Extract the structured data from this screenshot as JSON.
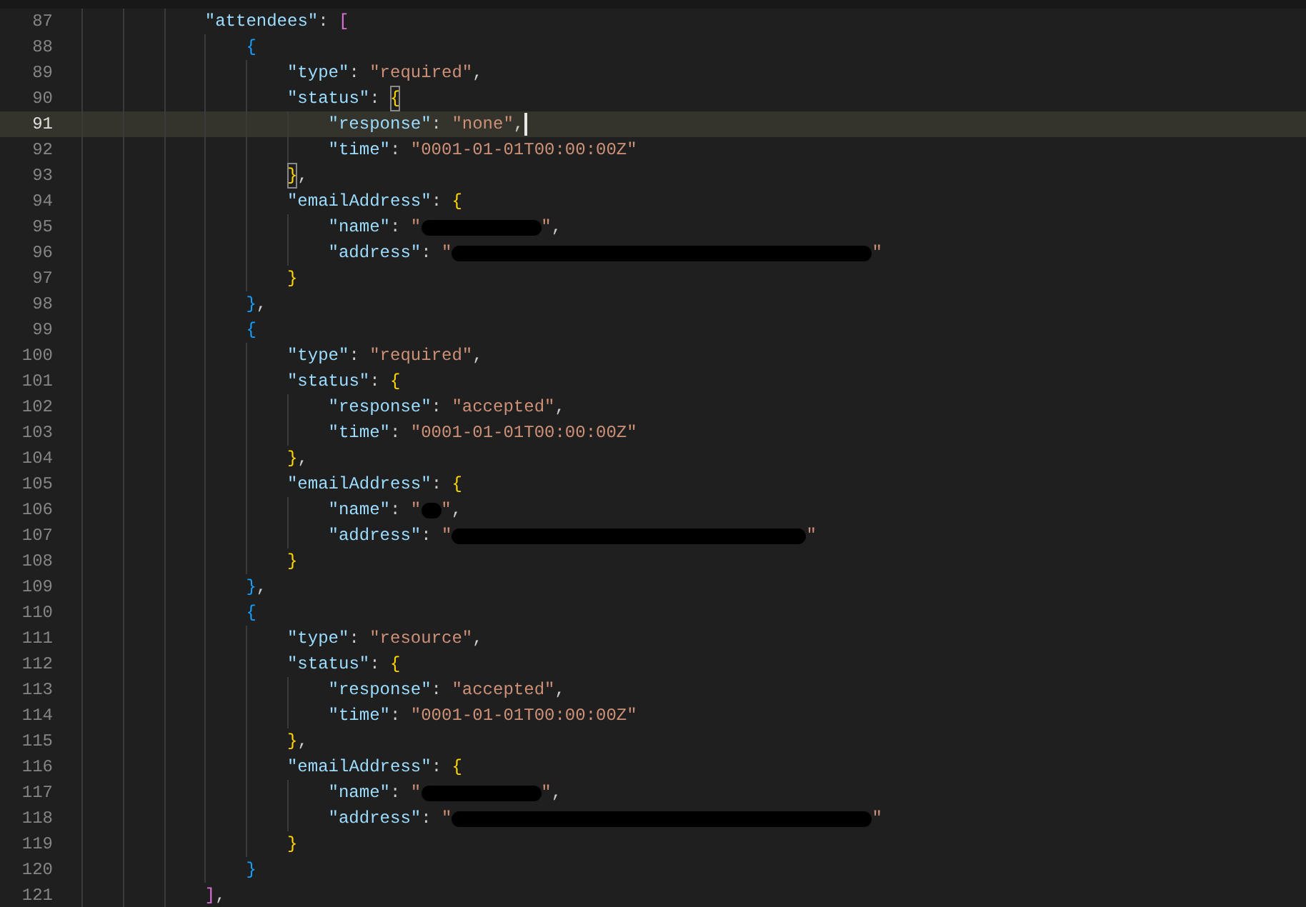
{
  "editor": {
    "lines": [
      {
        "number": "87",
        "current": false,
        "tokens": [
          {
            "kind": "key",
            "text": "\"attendees\""
          },
          {
            "kind": "punct",
            "text": ": "
          },
          {
            "kind": "bracket",
            "text": "[",
            "color": "#da70d6",
            "matched": false
          }
        ],
        "children": [
          {
            "number": "88",
            "current": false,
            "tokens": [
              {
                "kind": "bracket",
                "text": "{",
                "color": "#179fff",
                "matched": false
              }
            ],
            "children": [
              {
                "number": "89",
                "current": false,
                "tokens": [
                  {
                    "kind": "key",
                    "text": "\"type\""
                  },
                  {
                    "kind": "punct",
                    "text": ": "
                  },
                  {
                    "kind": "string",
                    "text": "\"required\""
                  },
                  {
                    "kind": "punct",
                    "text": ","
                  }
                ]
              },
              {
                "number": "90",
                "current": false,
                "tokens": [
                  {
                    "kind": "key",
                    "text": "\"status\""
                  },
                  {
                    "kind": "punct",
                    "text": ": "
                  },
                  {
                    "kind": "bracket",
                    "text": "{",
                    "color": "#ffd700",
                    "matched": true
                  }
                ],
                "children": [
                  {
                    "number": "91",
                    "current": true,
                    "tokens": [
                      {
                        "kind": "key",
                        "text": "\"response\""
                      },
                      {
                        "kind": "punct",
                        "text": ": "
                      },
                      {
                        "kind": "string",
                        "text": "\"none\""
                      },
                      {
                        "kind": "punct",
                        "text": ","
                      }
                    ]
                  },
                  {
                    "number": "92",
                    "current": false,
                    "tokens": [
                      {
                        "kind": "key",
                        "text": "\"time\""
                      },
                      {
                        "kind": "punct",
                        "text": ": "
                      },
                      {
                        "kind": "string",
                        "text": "\"0001-01-01T00:00:00Z\""
                      }
                    ]
                  }
                ]
              },
              {
                "number": "93",
                "current": false,
                "tokens": [
                  {
                    "kind": "bracket",
                    "text": "}",
                    "color": "#ffd700",
                    "matched": true
                  },
                  {
                    "kind": "punct",
                    "text": ","
                  }
                ]
              },
              {
                "number": "94",
                "current": false,
                "tokens": [
                  {
                    "kind": "key",
                    "text": "\"emailAddress\""
                  },
                  {
                    "kind": "punct",
                    "text": ": "
                  },
                  {
                    "kind": "bracket",
                    "text": "{",
                    "color": "#ffd700",
                    "matched": false
                  }
                ],
                "children": [
                  {
                    "number": "95",
                    "current": false,
                    "tokens": [
                      {
                        "kind": "key",
                        "text": "\"name\""
                      },
                      {
                        "kind": "punct",
                        "text": ": "
                      },
                      {
                        "kind": "string",
                        "text": "\""
                      },
                      {
                        "kind": "redaction-short"
                      },
                      {
                        "kind": "string",
                        "text": "\""
                      },
                      {
                        "kind": "punct",
                        "text": ","
                      }
                    ]
                  },
                  {
                    "number": "96",
                    "current": false,
                    "tokens": [
                      {
                        "kind": "key",
                        "text": "\"address\""
                      },
                      {
                        "kind": "punct",
                        "text": ": "
                      },
                      {
                        "kind": "string",
                        "text": "\""
                      },
                      {
                        "kind": "redaction-long"
                      },
                      {
                        "kind": "string",
                        "text": "\""
                      }
                    ]
                  }
                ]
              },
              {
                "number": "97",
                "current": false,
                "tokens": [
                  {
                    "kind": "bracket",
                    "text": "}",
                    "color": "#ffd700",
                    "matched": false
                  }
                ]
              }
            ]
          },
          {
            "number": "98",
            "current": false,
            "tokens": [
              {
                "kind": "bracket",
                "text": "}",
                "color": "#179fff",
                "matched": false
              },
              {
                "kind": "punct",
                "text": ","
              }
            ]
          },
          {
            "number": "99",
            "current": false,
            "tokens": [
              {
                "kind": "bracket",
                "text": "{",
                "color": "#179fff",
                "matched": false
              }
            ],
            "children": [
              {
                "number": "100",
                "current": false,
                "tokens": [
                  {
                    "kind": "key",
                    "text": "\"type\""
                  },
                  {
                    "kind": "punct",
                    "text": ": "
                  },
                  {
                    "kind": "string",
                    "text": "\"required\""
                  },
                  {
                    "kind": "punct",
                    "text": ","
                  }
                ]
              },
              {
                "number": "101",
                "current": false,
                "tokens": [
                  {
                    "kind": "key",
                    "text": "\"status\""
                  },
                  {
                    "kind": "punct",
                    "text": ": "
                  },
                  {
                    "kind": "bracket",
                    "text": "{",
                    "color": "#ffd700",
                    "matched": false
                  }
                ],
                "children": [
                  {
                    "number": "102",
                    "current": false,
                    "tokens": [
                      {
                        "kind": "key",
                        "text": "\"response\""
                      },
                      {
                        "kind": "punct",
                        "text": ": "
                      },
                      {
                        "kind": "string",
                        "text": "\"accepted\""
                      },
                      {
                        "kind": "punct",
                        "text": ","
                      }
                    ]
                  },
                  {
                    "number": "103",
                    "current": false,
                    "tokens": [
                      {
                        "kind": "key",
                        "text": "\"time\""
                      },
                      {
                        "kind": "punct",
                        "text": ": "
                      },
                      {
                        "kind": "string",
                        "text": "\"0001-01-01T00:00:00Z\""
                      }
                    ]
                  }
                ]
              },
              {
                "number": "104",
                "current": false,
                "tokens": [
                  {
                    "kind": "bracket",
                    "text": "}",
                    "color": "#ffd700",
                    "matched": false
                  },
                  {
                    "kind": "punct",
                    "text": ","
                  }
                ]
              },
              {
                "number": "105",
                "current": false,
                "tokens": [
                  {
                    "kind": "key",
                    "text": "\"emailAddress\""
                  },
                  {
                    "kind": "punct",
                    "text": ": "
                  },
                  {
                    "kind": "bracket",
                    "text": "{",
                    "color": "#ffd700",
                    "matched": false
                  }
                ],
                "children": [
                  {
                    "number": "106",
                    "current": false,
                    "tokens": [
                      {
                        "kind": "key",
                        "text": "\"name\""
                      },
                      {
                        "kind": "punct",
                        "text": ": "
                      },
                      {
                        "kind": "string",
                        "text": "\""
                      },
                      {
                        "kind": "redaction-tiny"
                      },
                      {
                        "kind": "string",
                        "text": "\""
                      },
                      {
                        "kind": "punct",
                        "text": ","
                      }
                    ]
                  },
                  {
                    "number": "107",
                    "current": false,
                    "tokens": [
                      {
                        "kind": "key",
                        "text": "\"address\""
                      },
                      {
                        "kind": "punct",
                        "text": ": "
                      },
                      {
                        "kind": "string",
                        "text": "\""
                      },
                      {
                        "kind": "redaction-medium"
                      },
                      {
                        "kind": "string",
                        "text": "\""
                      }
                    ]
                  }
                ]
              },
              {
                "number": "108",
                "current": false,
                "tokens": [
                  {
                    "kind": "bracket",
                    "text": "}",
                    "color": "#ffd700",
                    "matched": false
                  }
                ]
              }
            ]
          },
          {
            "number": "109",
            "current": false,
            "tokens": [
              {
                "kind": "bracket",
                "text": "}",
                "color": "#179fff",
                "matched": false
              },
              {
                "kind": "punct",
                "text": ","
              }
            ]
          },
          {
            "number": "110",
            "current": false,
            "tokens": [
              {
                "kind": "bracket",
                "text": "{",
                "color": "#179fff",
                "matched": false
              }
            ],
            "children": [
              {
                "number": "111",
                "current": false,
                "tokens": [
                  {
                    "kind": "key",
                    "text": "\"type\""
                  },
                  {
                    "kind": "punct",
                    "text": ": "
                  },
                  {
                    "kind": "string",
                    "text": "\"resource\""
                  },
                  {
                    "kind": "punct",
                    "text": ","
                  }
                ]
              },
              {
                "number": "112",
                "current": false,
                "tokens": [
                  {
                    "kind": "key",
                    "text": "\"status\""
                  },
                  {
                    "kind": "punct",
                    "text": ": "
                  },
                  {
                    "kind": "bracket",
                    "text": "{",
                    "color": "#ffd700",
                    "matched": false
                  }
                ],
                "children": [
                  {
                    "number": "113",
                    "current": false,
                    "tokens": [
                      {
                        "kind": "key",
                        "text": "\"response\""
                      },
                      {
                        "kind": "punct",
                        "text": ": "
                      },
                      {
                        "kind": "string",
                        "text": "\"accepted\""
                      },
                      {
                        "kind": "punct",
                        "text": ","
                      }
                    ]
                  },
                  {
                    "number": "114",
                    "current": false,
                    "tokens": [
                      {
                        "kind": "key",
                        "text": "\"time\""
                      },
                      {
                        "kind": "punct",
                        "text": ": "
                      },
                      {
                        "kind": "string",
                        "text": "\"0001-01-01T00:00:00Z\""
                      }
                    ]
                  }
                ]
              },
              {
                "number": "115",
                "current": false,
                "tokens": [
                  {
                    "kind": "bracket",
                    "text": "}",
                    "color": "#ffd700",
                    "matched": false
                  },
                  {
                    "kind": "punct",
                    "text": ","
                  }
                ]
              },
              {
                "number": "116",
                "current": false,
                "tokens": [
                  {
                    "kind": "key",
                    "text": "\"emailAddress\""
                  },
                  {
                    "kind": "punct",
                    "text": ": "
                  },
                  {
                    "kind": "bracket",
                    "text": "{",
                    "color": "#ffd700",
                    "matched": false
                  }
                ],
                "children": [
                  {
                    "number": "117",
                    "current": false,
                    "tokens": [
                      {
                        "kind": "key",
                        "text": "\"name\""
                      },
                      {
                        "kind": "punct",
                        "text": ": "
                      },
                      {
                        "kind": "string",
                        "text": "\""
                      },
                      {
                        "kind": "redaction-short"
                      },
                      {
                        "kind": "string",
                        "text": "\""
                      },
                      {
                        "kind": "punct",
                        "text": ","
                      }
                    ]
                  },
                  {
                    "number": "118",
                    "current": false,
                    "tokens": [
                      {
                        "kind": "key",
                        "text": "\"address\""
                      },
                      {
                        "kind": "punct",
                        "text": ": "
                      },
                      {
                        "kind": "string",
                        "text": "\""
                      },
                      {
                        "kind": "redaction-long"
                      },
                      {
                        "kind": "string",
                        "text": "\""
                      }
                    ]
                  }
                ]
              },
              {
                "number": "119",
                "current": false,
                "tokens": [
                  {
                    "kind": "bracket",
                    "text": "}",
                    "color": "#ffd700",
                    "matched": false
                  }
                ]
              }
            ]
          },
          {
            "number": "120",
            "current": false,
            "tokens": [
              {
                "kind": "bracket",
                "text": "}",
                "color": "#179fff",
                "matched": false
              }
            ]
          }
        ]
      },
      {
        "number": "121",
        "current": false,
        "tokens": [
          {
            "kind": "bracket",
            "text": "]",
            "color": "#da70d6",
            "matched": false
          },
          {
            "kind": "punct",
            "text": ","
          }
        ]
      }
    ]
  }
}
